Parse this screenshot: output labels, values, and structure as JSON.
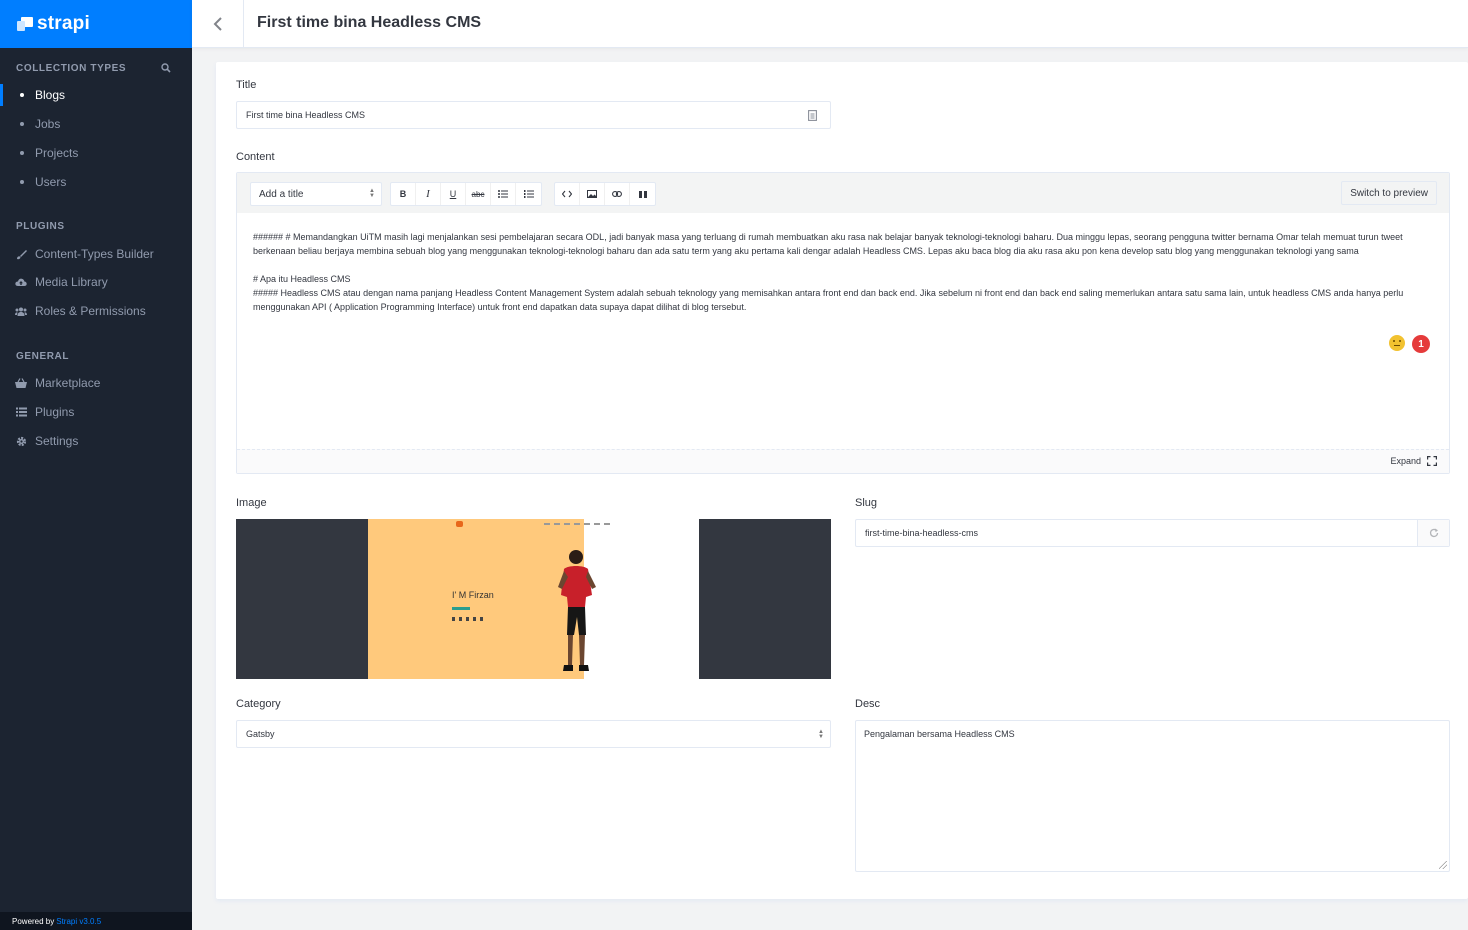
{
  "brand": {
    "name": "strapi"
  },
  "sidebar": {
    "collection_title": "COLLECTION TYPES",
    "collection_items": [
      {
        "label": "Blogs",
        "active": true
      },
      {
        "label": "Jobs"
      },
      {
        "label": "Projects"
      },
      {
        "label": "Users"
      }
    ],
    "plugins_title": "PLUGINS",
    "plugin_items": [
      {
        "label": "Content-Types Builder",
        "icon": "brush-icon"
      },
      {
        "label": "Media Library",
        "icon": "cloud-upload-icon"
      },
      {
        "label": "Roles & Permissions",
        "icon": "users-icon"
      }
    ],
    "general_title": "GENERAL",
    "general_items": [
      {
        "label": "Marketplace",
        "icon": "basket-icon"
      },
      {
        "label": "Plugins",
        "icon": "list-icon"
      },
      {
        "label": "Settings",
        "icon": "gear-icon"
      }
    ],
    "powered_prefix": "Powered by",
    "powered_link": "Strapi v3.0.5"
  },
  "header": {
    "title": "First time bina Headless CMS"
  },
  "form": {
    "title_label": "Title",
    "title_value": "First time bina Headless CMS",
    "content_label": "Content",
    "editor": {
      "heading_select": "Add a title",
      "buttons": [
        "B",
        "I",
        "U",
        "abc"
      ],
      "switch_label": "Switch to preview",
      "expand_label": "Expand",
      "paragraphs": [
        "###### #  Memandangkan UiTM masih lagi menjalankan sesi pembelajaran secara ODL, jadi banyak masa yang terluang di rumah membuatkan aku rasa nak belajar banyak teknologi-teknologi baharu. Dua minggu lepas, seorang pengguna twitter bernama Omar telah memuat turun tweet berkenaan beliau berjaya membina sebuah blog yang menggunakan teknologi-teknologi baharu dan ada satu term yang aku pertama kali dengar adalah Headless CMS. Lepas aku baca blog dia aku rasa aku pon kena develop satu blog yang menggunakan teknologi yang sama",
        "# Apa itu Headless CMS",
        "##### Headless CMS  atau dengan nama panjang Headless Content Management System adalah sebuah teknology yang memisahkan antara front end dan back end. Jika sebelum ni front end dan back end saling memerlukan antara satu sama lain, untuk headless CMS anda hanya perlu menggunakan API ( Application Programming Interface) untuk front end dapatkan data supaya dapat dilihat di blog tersebut."
      ],
      "badge_count": "1"
    },
    "image_label": "Image",
    "image_preview_text": "I' M Firzan",
    "slug_label": "Slug",
    "slug_value": "first-time-bina-headless-cms",
    "category_label": "Category",
    "category_value": "Gatsby",
    "desc_label": "Desc",
    "desc_value": "Pengalaman bersama Headless CMS"
  },
  "colors": {
    "brand": "#007eff",
    "sidebar_bg": "#1c2431",
    "badge": "#e53b3b"
  }
}
